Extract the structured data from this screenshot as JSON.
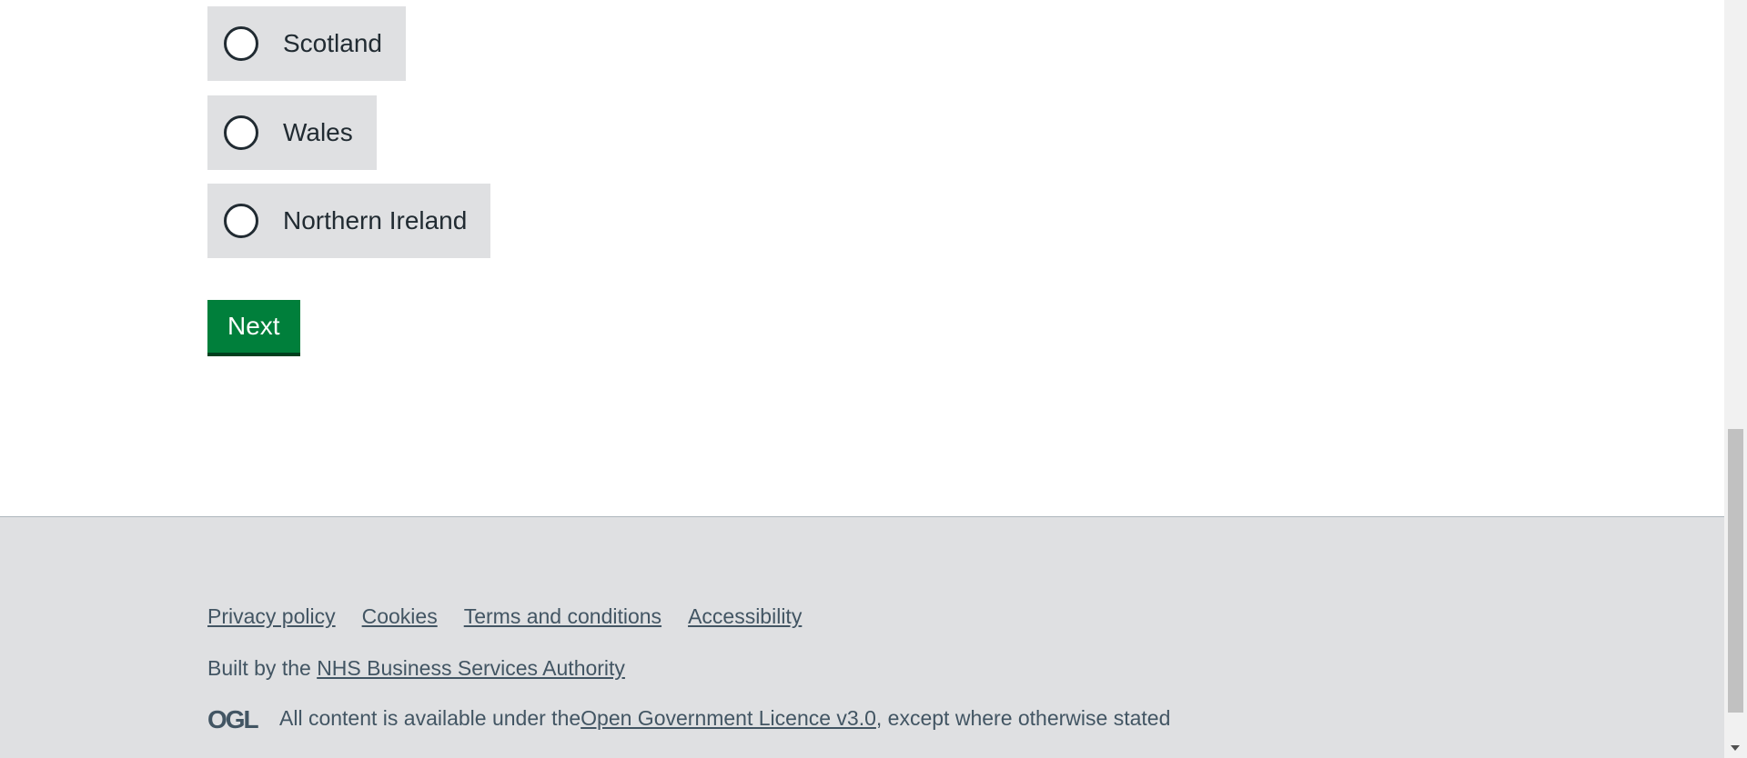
{
  "form": {
    "options": [
      {
        "label": "Scotland",
        "selected": false
      },
      {
        "label": "Wales",
        "selected": false
      },
      {
        "label": "Northern Ireland",
        "selected": false
      }
    ],
    "next_label": "Next"
  },
  "footer": {
    "links": [
      {
        "label": "Privacy policy"
      },
      {
        "label": "Cookies"
      },
      {
        "label": "Terms and conditions"
      },
      {
        "label": "Accessibility"
      }
    ],
    "built_by_prefix": "Built by the ",
    "built_by_link": "NHS Business Services Authority",
    "licence_logo_text": "OGL",
    "licence_prefix": "All content is available under the ",
    "licence_link": "Open Government Licence v3.0",
    "licence_suffix": ", except where otherwise stated"
  },
  "colors": {
    "button_green": "#007f3b",
    "option_background": "#dfe0e2",
    "footer_background": "#dfe0e2",
    "footer_text": "#425563"
  }
}
